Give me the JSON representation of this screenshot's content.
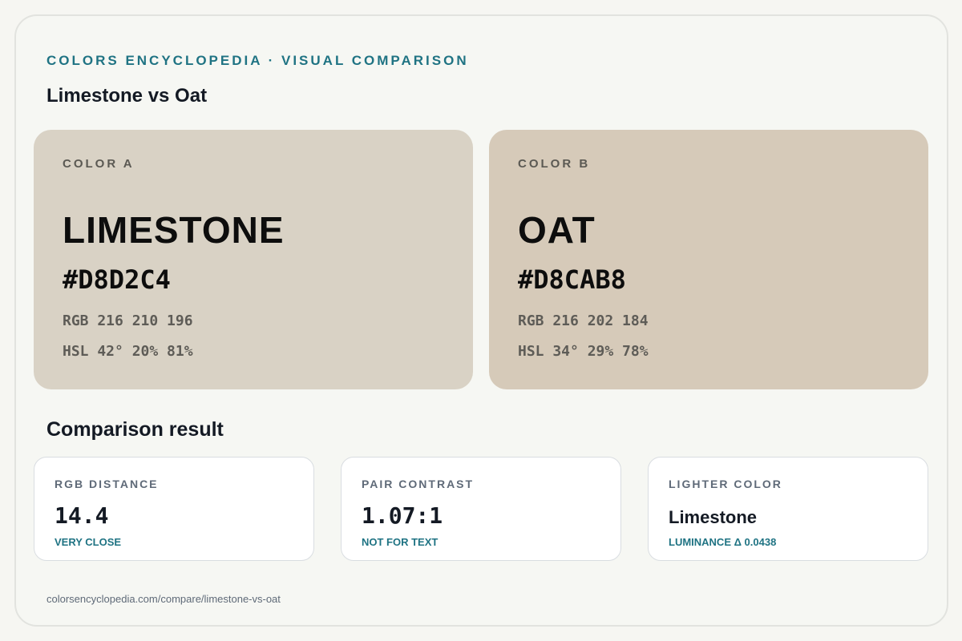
{
  "header": {
    "eyebrow": "COLORS ENCYCLOPEDIA · VISUAL COMPARISON",
    "title": "Limestone vs Oat"
  },
  "colors": [
    {
      "label": "COLOR A",
      "name": "LIMESTONE",
      "hex": "#D8D2C4",
      "rgb": "RGB 216 210 196",
      "hsl": "HSL 42° 20% 81%",
      "swatch": "#d9d2c5"
    },
    {
      "label": "COLOR B",
      "name": "OAT",
      "hex": "#D8CAB8",
      "rgb": "RGB 216 202 184",
      "hsl": "HSL 34° 29% 78%",
      "swatch": "#d6cab9"
    }
  ],
  "comparison": {
    "title": "Comparison result",
    "cards": [
      {
        "label": "RGB DISTANCE",
        "value": "14.4",
        "note": "VERY CLOSE"
      },
      {
        "label": "PAIR CONTRAST",
        "value": "1.07:1",
        "note": "NOT FOR TEXT"
      },
      {
        "label": "LIGHTER COLOR",
        "value": "Limestone",
        "note": "LUMINANCE Δ 0.0438"
      }
    ]
  },
  "footer": {
    "url": "colorsencyclopedia.com/compare/limestone-vs-oat"
  },
  "theme": {
    "accent": "#1f7383",
    "background": "#f6f6f2"
  }
}
